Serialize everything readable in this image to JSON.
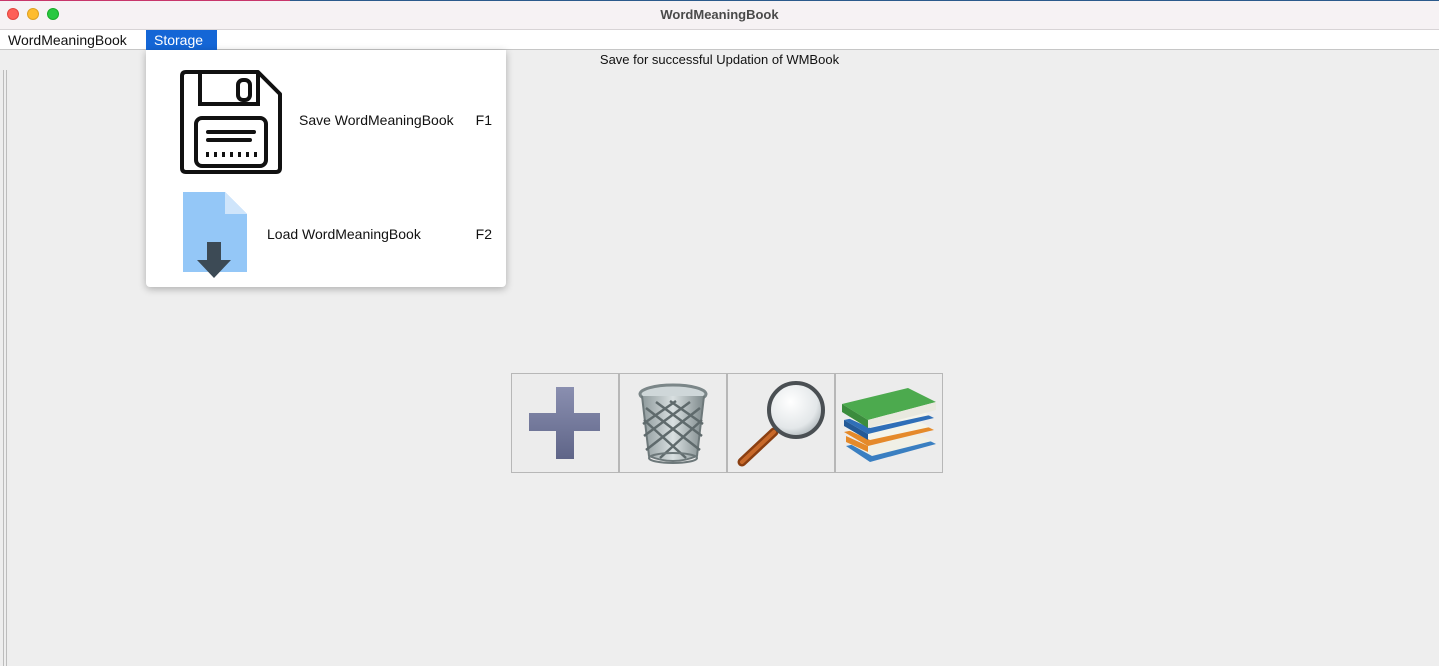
{
  "window": {
    "title": "WordMeaningBook"
  },
  "menubar": {
    "items": [
      {
        "label": "WordMeaningBook"
      },
      {
        "label": "Storage"
      }
    ]
  },
  "status": {
    "message": "Save for successful Updation of WMBook"
  },
  "storage_menu": {
    "items": [
      {
        "label": "Save WordMeaningBook",
        "shortcut": "F1",
        "icon": "floppy-disk-icon"
      },
      {
        "label": "Load WordMeaningBook",
        "shortcut": "F2",
        "icon": "file-download-icon"
      }
    ]
  },
  "toolbar": {
    "buttons": [
      {
        "icon": "plus-icon"
      },
      {
        "icon": "trash-bin-icon"
      },
      {
        "icon": "magnifying-glass-icon"
      },
      {
        "icon": "books-icon"
      }
    ]
  },
  "colors": {
    "menu_highlight": "#1466d6",
    "titlebar_bg": "#f6f2f4",
    "window_bg": "#eeeeee"
  }
}
